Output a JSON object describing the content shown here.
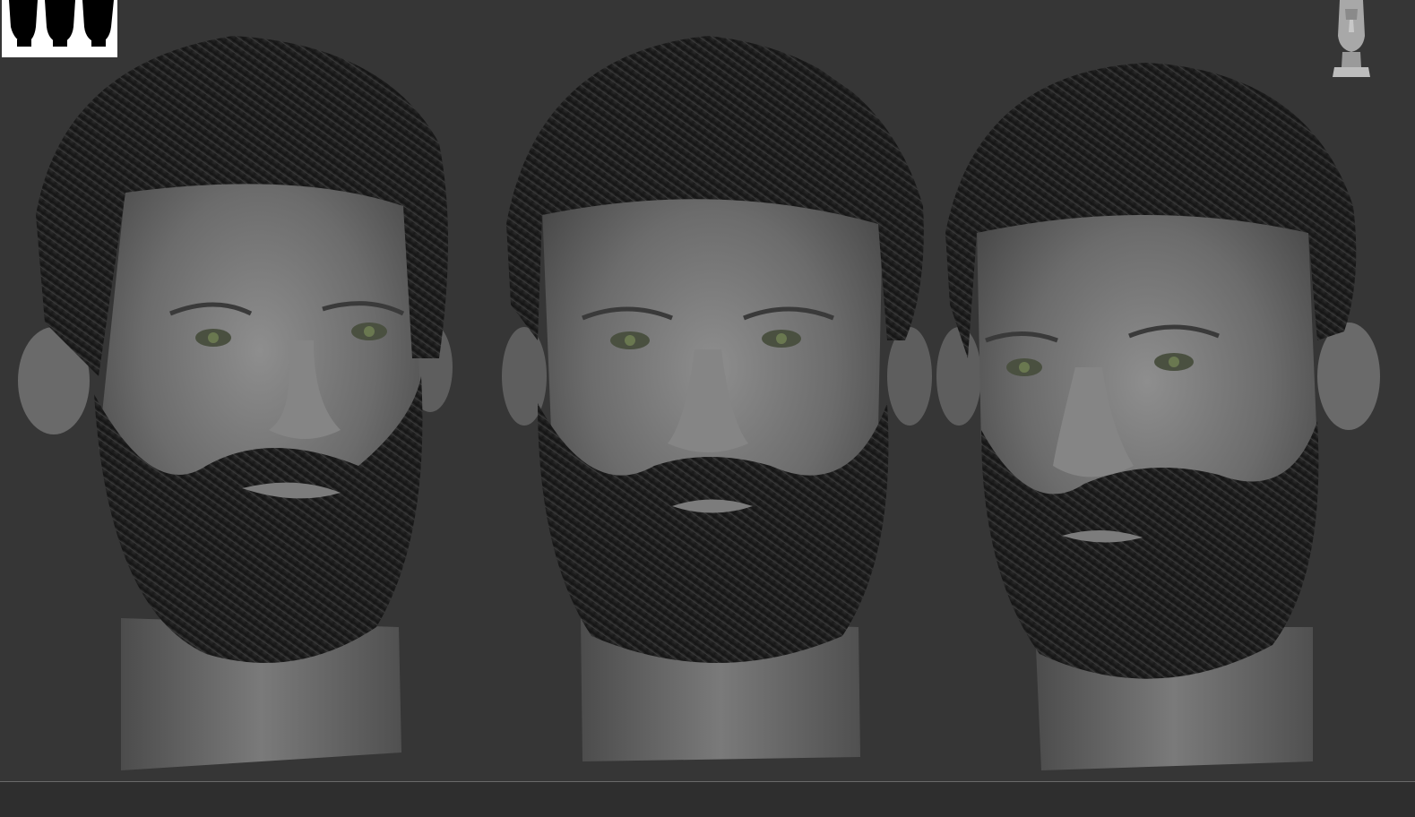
{
  "viewport": {
    "background": "#363636",
    "renders": [
      {
        "name": "head-render-left",
        "view": "three-quarter-left"
      },
      {
        "name": "head-render-front",
        "view": "front"
      },
      {
        "name": "head-render-right",
        "view": "three-quarter-right"
      }
    ]
  },
  "thumbnail": {
    "icon": "silhouette-views-thumbnail"
  },
  "gizmo": {
    "icon": "head-navigation-gizmo-icon"
  }
}
